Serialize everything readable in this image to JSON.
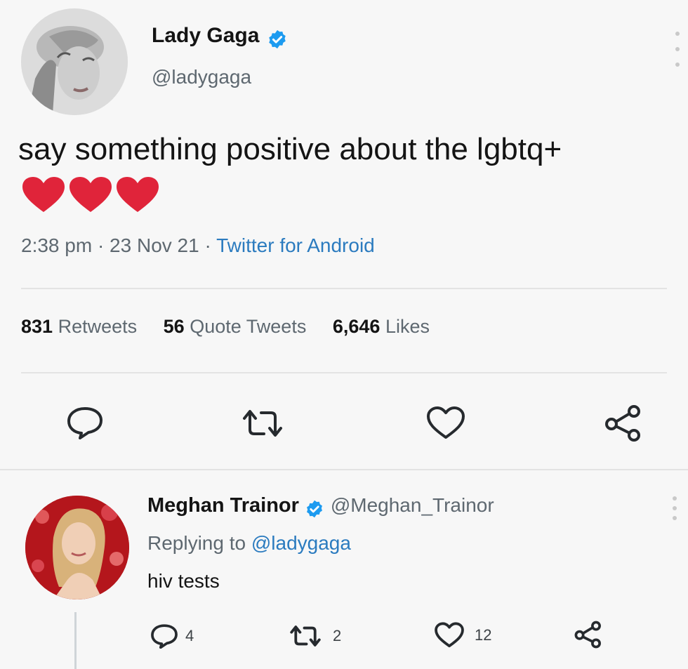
{
  "main_tweet": {
    "author": {
      "name": "Lady Gaga",
      "handle": "@ladygaga",
      "verified": true
    },
    "text": "say something positive about the lgbtq+",
    "emoji": "❤❤❤",
    "timestamp": "2:38 pm · 23 Nov 21 · ",
    "source": "Twitter for Android",
    "stats": {
      "retweets_count": "831",
      "retweets_label": "Retweets",
      "quotes_count": "56",
      "quotes_label": "Quote Tweets",
      "likes_count": "6,646",
      "likes_label": "Likes"
    },
    "actions": [
      "reply-icon",
      "retweet-icon",
      "like-icon",
      "share-icon"
    ]
  },
  "reply_tweet": {
    "author": {
      "name": "Meghan Trainor",
      "handle": "@Meghan_Trainor",
      "verified": true
    },
    "replying_prefix": "Replying to ",
    "replying_to": "@ladygaga",
    "text": "hiv tests",
    "counts": {
      "replies": "4",
      "retweets": "2",
      "likes": "12"
    }
  },
  "colors": {
    "accent": "#1d9bf0",
    "link": "#2b7bbf",
    "heart": "#e0243a",
    "muted": "#5e6870"
  }
}
